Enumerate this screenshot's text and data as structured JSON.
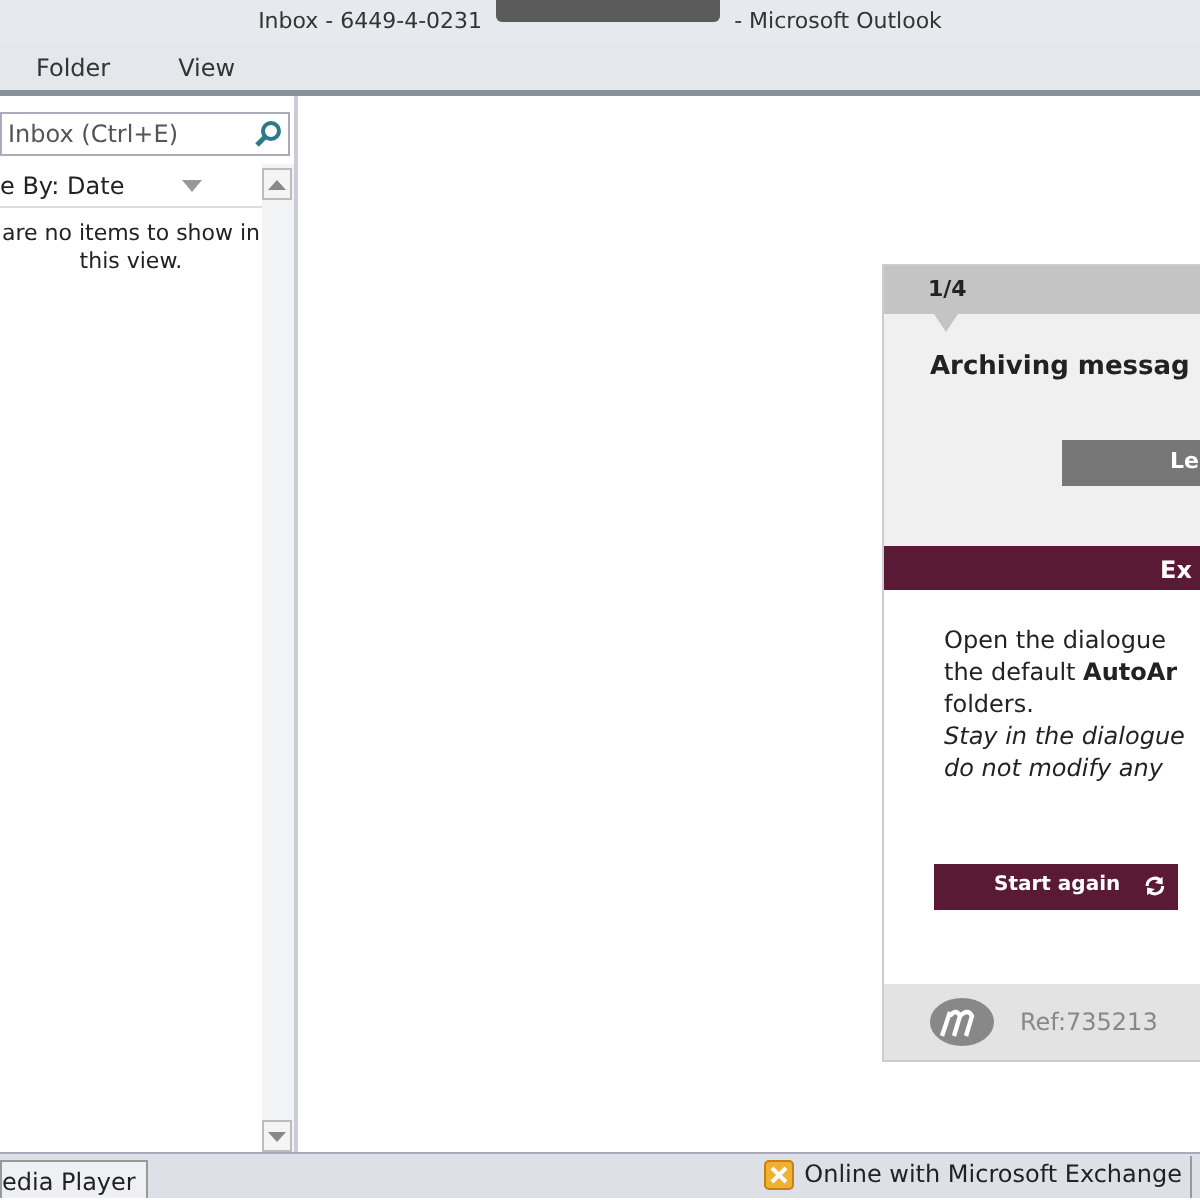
{
  "window": {
    "title_start": "Inbox - 6449-4-0231",
    "title_end": "- Microsoft Outlook"
  },
  "ribbon_tabs": [
    {
      "label": "Folder",
      "selected": false
    },
    {
      "label": "View",
      "selected": false
    }
  ],
  "search": {
    "placeholder": "Inbox (Ctrl+E)"
  },
  "arrange": {
    "label": "e By: Date"
  },
  "empty_message": "are no items to show in this view.",
  "dialog": {
    "step": "1/4",
    "title": "Archiving messag",
    "grey_button": "Le",
    "section_title": "Ex",
    "lines": [
      {
        "text": "Open the dialogue",
        "italic": false
      },
      {
        "text": "the default **AutoAr**",
        "italic": false
      },
      {
        "text": "folders.",
        "italic": false
      },
      {
        "text": "Stay in the dialogue",
        "italic": true
      },
      {
        "text": "do not modify any",
        "italic": true
      }
    ],
    "start_button": "Start again",
    "ref": "Ref:735213"
  },
  "status_bar": {
    "task": "edia Player",
    "connection": "Online with Microsoft Exchange"
  }
}
